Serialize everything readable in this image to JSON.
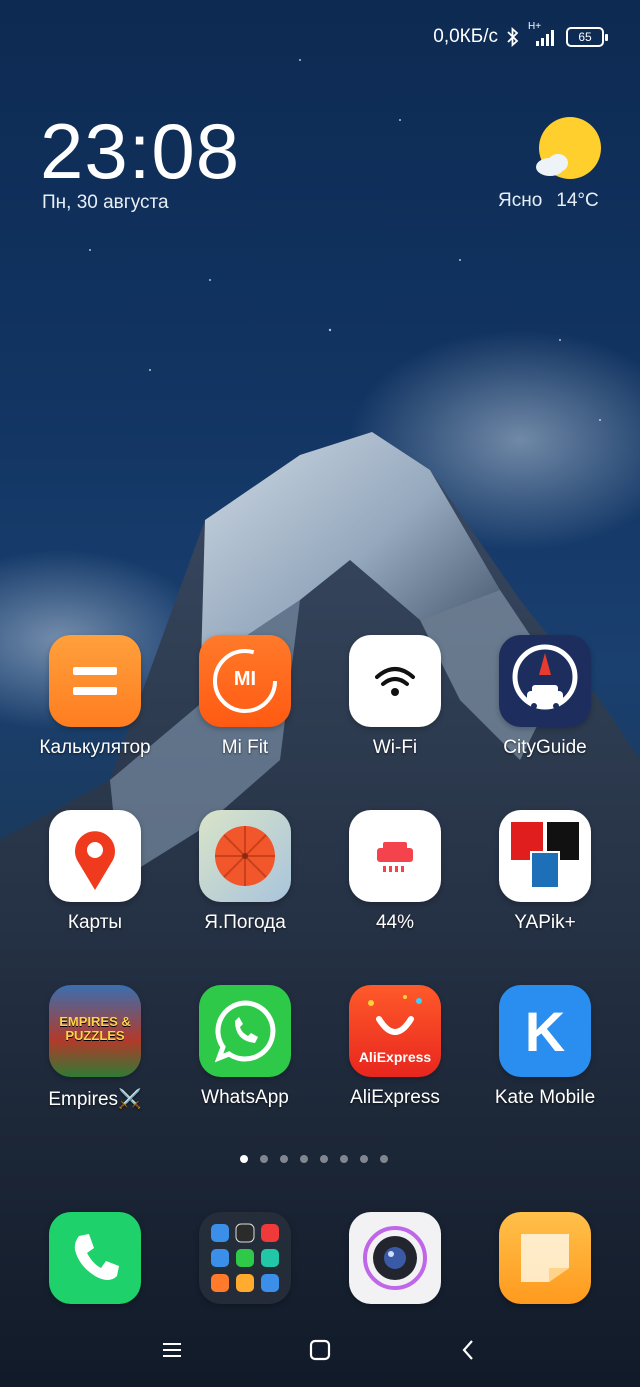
{
  "status": {
    "network_speed": "0,0КБ/с",
    "network_type": "H+",
    "battery": "65"
  },
  "clock": {
    "time": "23:08",
    "date": "Пн, 30 августа"
  },
  "weather": {
    "condition": "Ясно",
    "temperature": "14°C",
    "icon": "sun-cloud-icon"
  },
  "apps": [
    {
      "label": "Калькулятор",
      "icon": "calculator-icon"
    },
    {
      "label": "Mi Fit",
      "icon": "mi-fit-icon"
    },
    {
      "label": "Wi-Fi",
      "icon": "wifi-icon"
    },
    {
      "label": "CityGuide",
      "icon": "cityguide-icon"
    },
    {
      "label": "Карты",
      "icon": "maps-pin-icon"
    },
    {
      "label": "Я.Погода",
      "icon": "umbrella-icon"
    },
    {
      "label": "44%",
      "icon": "cleaner-icon"
    },
    {
      "label": "YAPik+",
      "icon": "yapik-icon"
    },
    {
      "label": "Empires⚔️",
      "icon": "empires-game-icon"
    },
    {
      "label": "WhatsApp",
      "icon": "whatsapp-icon"
    },
    {
      "label": "AliExpress",
      "icon": "aliexpress-icon"
    },
    {
      "label": "Kate Mobile",
      "icon": "kate-mobile-icon"
    }
  ],
  "empires_logo_text": "EMPIRES & PUZZLES",
  "aliexpress_logo_text": "AliExpress",
  "kate_letter": "K",
  "mi_logo_text": "MI",
  "page_indicator": {
    "count": 8,
    "active": 0
  },
  "dock": [
    {
      "icon": "phone-icon"
    },
    {
      "icon": "folder-icon"
    },
    {
      "icon": "camera-icon"
    },
    {
      "icon": "notes-icon"
    }
  ],
  "nav": [
    {
      "icon": "menu-icon"
    },
    {
      "icon": "home-icon"
    },
    {
      "icon": "back-icon"
    }
  ],
  "colors": {
    "calculator": "#ff8a2b",
    "mifit": "#ff6a1f",
    "whatsapp": "#2fc94a",
    "kate": "#2a8ef0",
    "phone": "#1fd16a",
    "notes": "#ffab2e"
  }
}
